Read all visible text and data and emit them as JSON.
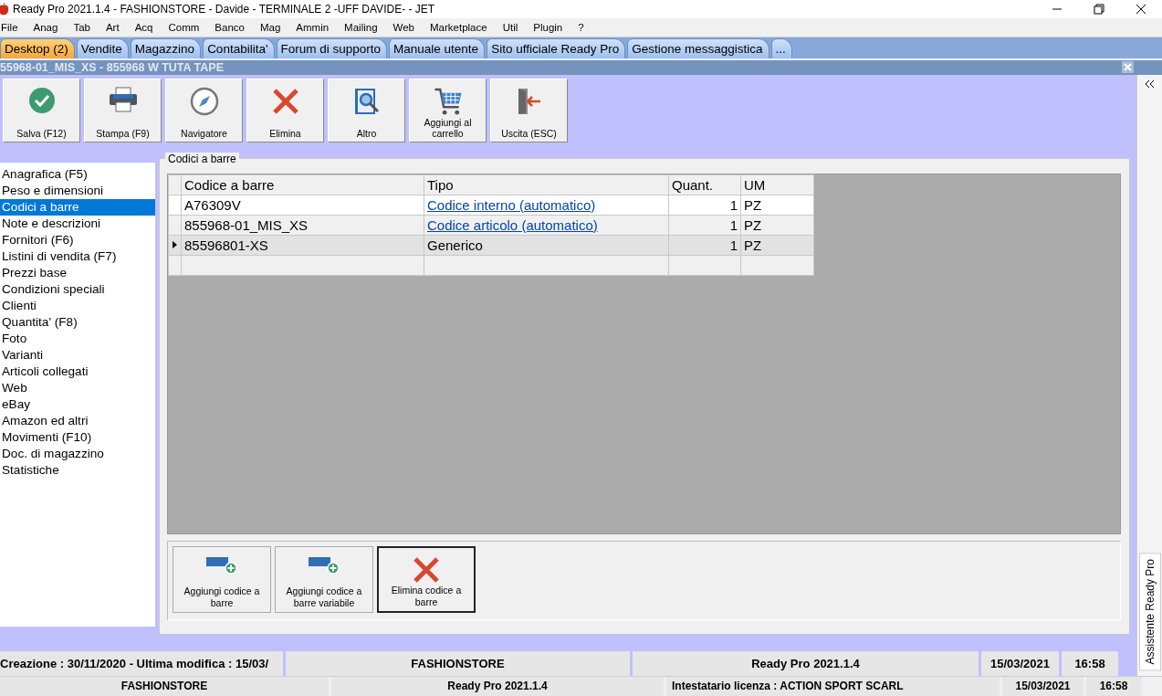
{
  "window": {
    "title": "Ready Pro 2021.1.4 - FASHIONSTORE - Davide - TERMINALE 2 -UFF DAVIDE- - JET"
  },
  "menu": [
    "File",
    "Anag",
    "Tab",
    "Art",
    "Acq",
    "Comm",
    "Banco",
    "Mag",
    "Ammin",
    "Mailing",
    "Web",
    "Marketplace",
    "Util",
    "Plugin",
    "?"
  ],
  "tabs": [
    {
      "label": "Desktop (2)",
      "selected": true
    },
    {
      "label": "Vendite",
      "selected": false
    },
    {
      "label": "Magazzino",
      "selected": false
    },
    {
      "label": "Contabilita'",
      "selected": false
    },
    {
      "label": "Forum di supporto",
      "selected": false
    },
    {
      "label": "Manuale utente",
      "selected": false
    },
    {
      "label": "Sito ufficiale Ready Pro",
      "selected": false
    },
    {
      "label": "Gestione messaggistica",
      "selected": false
    },
    {
      "label": "...",
      "selected": false
    }
  ],
  "document": {
    "title": "55968-01_MIS_XS - 855968 W TUTA TAPE"
  },
  "toolbar": [
    {
      "label": "Salva (F12)",
      "kind": "save"
    },
    {
      "label": "Stampa (F9)",
      "kind": "print"
    },
    {
      "label": "Navigatore",
      "kind": "compass"
    },
    {
      "label": "Elimina",
      "kind": "delete"
    },
    {
      "label": "Altro",
      "kind": "book"
    },
    {
      "label": "Aggiungi al carrello",
      "kind": "cart"
    },
    {
      "label": "Uscita (ESC)",
      "kind": "exit"
    }
  ],
  "sidebar": {
    "items": [
      {
        "label": "Anagrafica (F5)",
        "selected": false
      },
      {
        "label": "Peso e dimensioni",
        "selected": false
      },
      {
        "label": "Codici a barre",
        "selected": true
      },
      {
        "label": "Note e descrizioni",
        "selected": false
      },
      {
        "label": "Fornitori (F6)",
        "selected": false
      },
      {
        "label": "Listini di vendita (F7)",
        "selected": false
      },
      {
        "label": "Prezzi base",
        "selected": false
      },
      {
        "label": "Condizioni speciali",
        "selected": false
      },
      {
        "label": "Clienti",
        "selected": false
      },
      {
        "label": "Quantita' (F8)",
        "selected": false
      },
      {
        "label": "Foto",
        "selected": false
      },
      {
        "label": "Varianti",
        "selected": false
      },
      {
        "label": "Articoli collegati",
        "selected": false
      },
      {
        "label": "Web",
        "selected": false
      },
      {
        "label": "eBay",
        "selected": false
      },
      {
        "label": "Amazon ed altri",
        "selected": false
      },
      {
        "label": "Movimenti (F10)",
        "selected": false
      },
      {
        "label": "Doc. di magazzino",
        "selected": false
      },
      {
        "label": "Statistiche",
        "selected": false
      }
    ]
  },
  "group": {
    "title": "Codici a barre"
  },
  "table": {
    "columns": [
      "Codice a barre",
      "Tipo",
      "Quant.",
      "UM"
    ],
    "rows": [
      {
        "code": "A76309V",
        "type": "Codice interno (automatico)",
        "type_link": true,
        "qty": "1",
        "um": "PZ",
        "selected": false
      },
      {
        "code": "855968-01_MIS_XS",
        "type": "Codice articolo (automatico)",
        "type_link": true,
        "qty": "1",
        "um": "PZ",
        "selected": false
      },
      {
        "code": "85596801-XS",
        "type": "Generico",
        "type_link": false,
        "qty": "1",
        "um": "PZ",
        "selected": true
      }
    ]
  },
  "actions": [
    {
      "label": "Aggiungi codice a barre",
      "kind": "add",
      "focused": false
    },
    {
      "label": "Aggiungi codice a barre variabile",
      "kind": "add",
      "focused": false
    },
    {
      "label": "Elimina codice a barre",
      "kind": "delete",
      "focused": true
    }
  ],
  "side_panel": {
    "label": "Assistente Ready Pro"
  },
  "status_bar": [
    "Creazione : 30/11/2020 - Ultima modifica : 15/03/",
    "FASHIONSTORE",
    "Ready Pro 2021.1.4",
    "15/03/2021",
    "16:58"
  ],
  "status_bar_2": [
    "FASHIONSTORE",
    "Ready Pro 2021.1.4",
    "Intestatario licenza : ACTION SPORT SCARL",
    "15/03/2021",
    "16:58"
  ]
}
